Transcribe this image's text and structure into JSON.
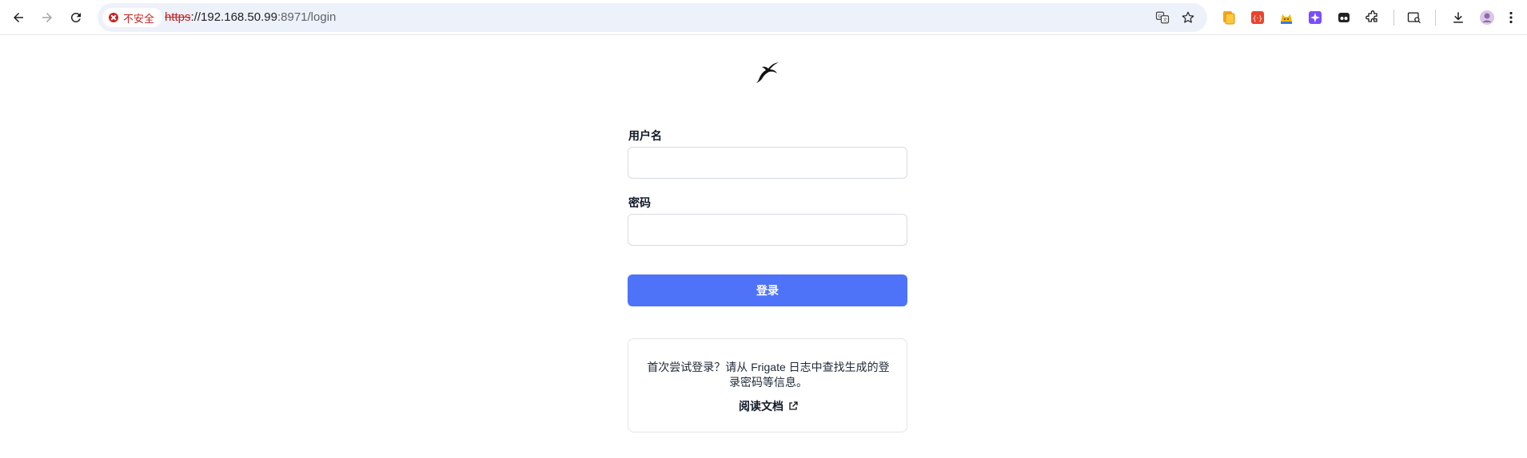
{
  "browser": {
    "security_label": "不安全",
    "url_scheme": "https",
    "url_host": "://192.168.50.99",
    "url_path": ":8971/login",
    "icons": [
      "back-icon",
      "forward-icon",
      "reload-icon",
      "translate-icon",
      "bookmark-star-icon",
      "extension-icons",
      "puzzle-icon",
      "tab-search-icon",
      "download-icon",
      "profile-avatar",
      "menu-icon"
    ]
  },
  "login": {
    "username_label": "用户名",
    "username_value": "",
    "password_label": "密码",
    "password_value": "",
    "submit_label": "登录"
  },
  "info": {
    "message": "首次尝试登录？请从 Frigate 日志中查找生成的登录密码等信息。",
    "docs_link": "阅读文档"
  },
  "colors": {
    "accent": "#4e73f8",
    "insecure": "#c5221f",
    "omnibox": "#edf1fa"
  }
}
